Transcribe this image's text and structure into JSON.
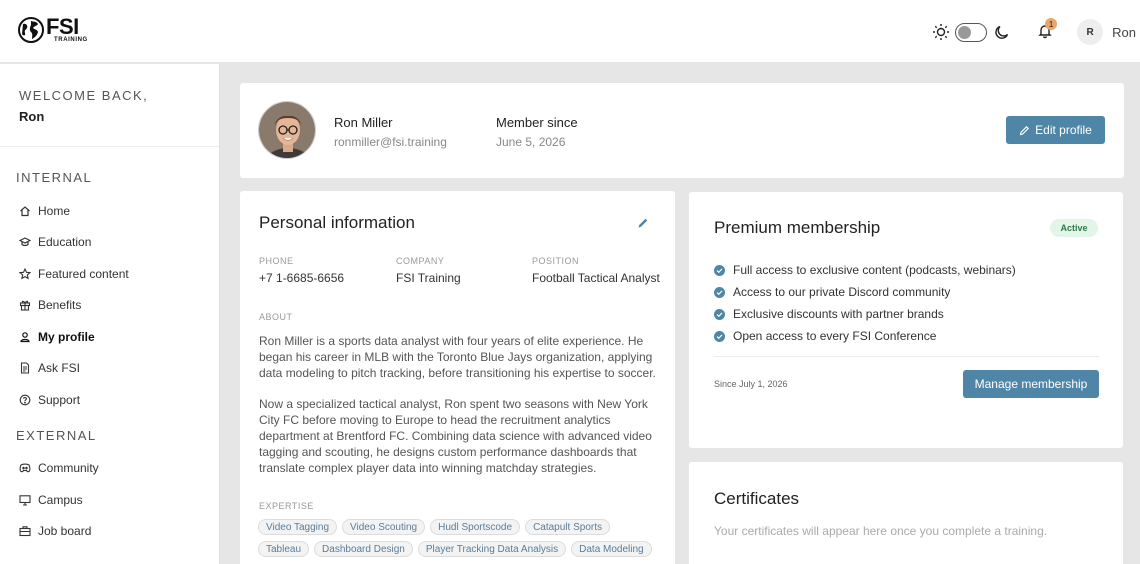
{
  "brand": {
    "name": "FSI",
    "subtitle": "TRAINING"
  },
  "header": {
    "notification_count": "1",
    "avatar_initial": "R",
    "user_name": "Ron"
  },
  "sidebar": {
    "welcome_label": "WELCOME BACK,",
    "welcome_name": "Ron",
    "internal_title": "INTERNAL",
    "internal_items": [
      {
        "label": "Home",
        "icon": "home-icon"
      },
      {
        "label": "Education",
        "icon": "graduation-cap-icon"
      },
      {
        "label": "Featured content",
        "icon": "star-icon"
      },
      {
        "label": "Benefits",
        "icon": "gift-icon"
      },
      {
        "label": "My profile",
        "icon": "user-icon"
      },
      {
        "label": "Ask FSI",
        "icon": "document-icon"
      },
      {
        "label": "Support",
        "icon": "help-circle-icon"
      }
    ],
    "external_title": "EXTERNAL",
    "external_items": [
      {
        "label": "Community",
        "icon": "discord-icon"
      },
      {
        "label": "Campus",
        "icon": "monitor-icon"
      },
      {
        "label": "Job board",
        "icon": "briefcase-icon"
      }
    ]
  },
  "profile": {
    "name": "Ron Miller",
    "email": "ronmiller@fsi.training",
    "member_since_label": "Member since",
    "member_since_value": "June 5, 2026",
    "edit_label": "Edit profile"
  },
  "personal": {
    "title": "Personal information",
    "phone_label": "PHONE",
    "phone_value": "+7 1-6685-6656",
    "company_label": "COMPANY",
    "company_value": "FSI Training",
    "position_label": "POSITION",
    "position_value": "Football Tactical Analyst",
    "about_label": "ABOUT",
    "about_p1": "Ron Miller is a sports data analyst with four years of elite experience. He began his career in MLB with the Toronto Blue Jays organization, applying data modeling to pitch tracking, before transitioning his expertise to soccer.",
    "about_p2": "Now a specialized tactical analyst, Ron spent two seasons with New York City FC before moving to Europe to head the recruitment analytics department at Brentford FC. Combining data science with advanced video tagging and scouting, he designs custom performance dashboards that translate complex player data into winning matchday strategies.",
    "expertise_label": "EXPERTISE",
    "expertise": [
      "Video Tagging",
      "Video Scouting",
      "Hudl Sportscode",
      "Catapult Sports",
      "Tableau",
      "Dashboard Design",
      "Player Tracking Data Analysis",
      "Data Modeling"
    ]
  },
  "premium": {
    "title": "Premium membership",
    "status": "Active",
    "benefits": [
      "Full access to exclusive content (podcasts, webinars)",
      "Access to our private Discord community",
      "Exclusive discounts with partner brands",
      "Open access to every FSI Conference"
    ],
    "since": "Since July 1, 2026",
    "manage_label": "Manage membership"
  },
  "certificates": {
    "title": "Certificates",
    "empty_text": "Your certificates will appear here once you complete a training."
  },
  "colors": {
    "accent": "#4f86a8",
    "active_badge_bg": "#e3f4e8",
    "active_badge_text": "#2e7a48",
    "notification": "#e8a56a"
  }
}
